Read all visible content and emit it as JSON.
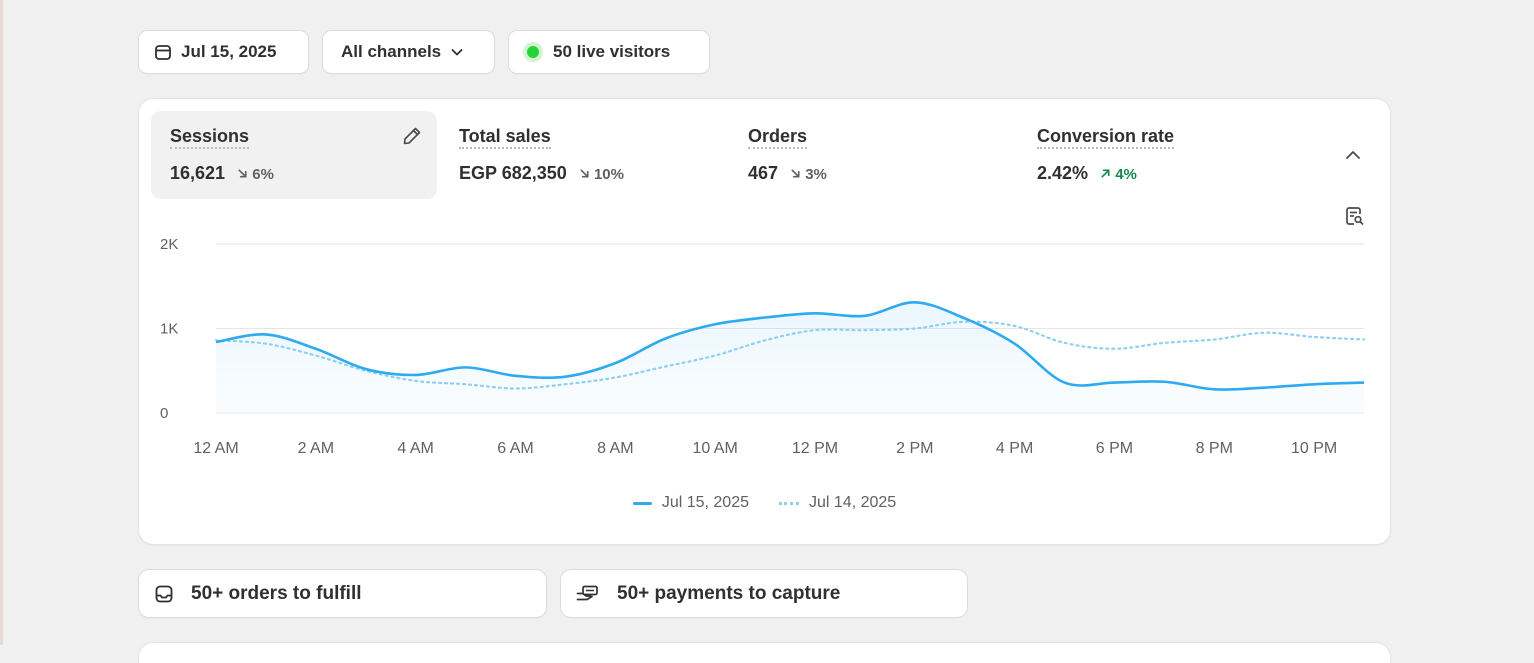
{
  "filters": {
    "date_label": "Jul 15, 2025",
    "channels_label": "All channels",
    "live_label": "50 live visitors"
  },
  "metrics": [
    {
      "label": "Sessions",
      "value": "16,621",
      "change": "6%",
      "direction": "down",
      "active": true
    },
    {
      "label": "Total sales",
      "value": "EGP 682,350",
      "change": "10%",
      "direction": "down"
    },
    {
      "label": "Orders",
      "value": "467",
      "change": "3%",
      "direction": "down"
    },
    {
      "label": "Conversion rate",
      "value": "2.42%",
      "change": "4%",
      "direction": "up"
    }
  ],
  "icons": {
    "calendar": "calendar-icon",
    "chevron": "chevron-down-icon",
    "edit": "pencil-icon",
    "collapse": "chevron-up-icon",
    "insight": "report-search-icon",
    "inbox": "inbox-icon",
    "payment": "hand-money-icon"
  },
  "colors": {
    "current_series": "#2eaaf0",
    "previous_series": "#8fcff2",
    "live_dot": "#24d336",
    "positive_change": "#15894a"
  },
  "chart_data": {
    "type": "line",
    "x": [
      "12 AM",
      "1 AM",
      "2 AM",
      "3 AM",
      "4 AM",
      "5 AM",
      "6 AM",
      "7 AM",
      "8 AM",
      "9 AM",
      "10 AM",
      "11 AM",
      "12 PM",
      "1 PM",
      "2 PM",
      "3 PM",
      "4 PM",
      "5 PM",
      "6 PM",
      "7 PM",
      "8 PM",
      "9 PM",
      "10 PM",
      "11 PM"
    ],
    "x_tick_labels": [
      "12 AM",
      "2 AM",
      "4 AM",
      "6 AM",
      "8 AM",
      "10 AM",
      "12 PM",
      "2 PM",
      "4 PM",
      "6 PM",
      "8 PM",
      "10 PM"
    ],
    "y_tick_labels": [
      "0",
      "1K",
      "2K"
    ],
    "ylim": [
      0,
      2000
    ],
    "grid": true,
    "legend_position": "bottom-center",
    "series": [
      {
        "name": "Jul 15, 2025",
        "style": "solid",
        "values": [
          840,
          930,
          760,
          520,
          450,
          540,
          440,
          430,
          590,
          880,
          1050,
          1130,
          1180,
          1150,
          1310,
          1120,
          820,
          360,
          360,
          370,
          280,
          300,
          340,
          360
        ]
      },
      {
        "name": "Jul 14, 2025",
        "style": "dotted",
        "values": [
          860,
          820,
          680,
          500,
          380,
          340,
          290,
          340,
          420,
          550,
          680,
          860,
          980,
          980,
          1000,
          1080,
          1030,
          830,
          760,
          830,
          870,
          950,
          900,
          870
        ]
      }
    ]
  },
  "legend": {
    "current": "Jul 15, 2025",
    "previous": "Jul 14, 2025"
  },
  "tasks": {
    "fulfill_label": "50+ orders to fulfill",
    "capture_label": "50+ payments to capture"
  }
}
